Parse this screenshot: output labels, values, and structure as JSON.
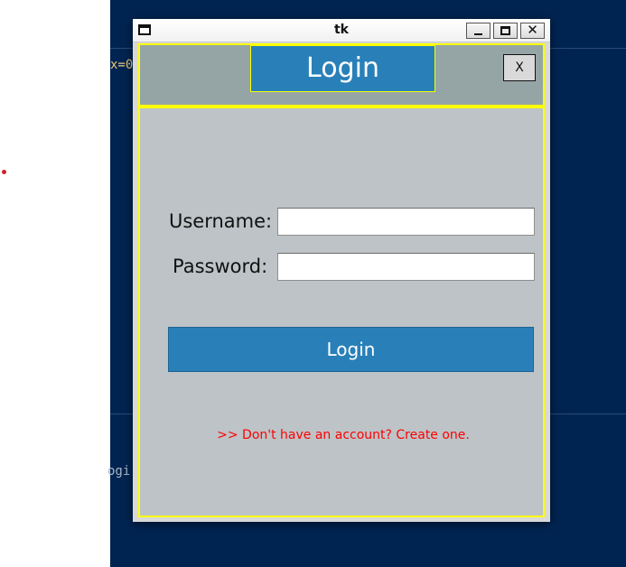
{
  "background": {
    "editor_line_1": "x=0",
    "editor_line_2": "",
    "editor_line_3": "ogi",
    "editor_line_4": ""
  },
  "window": {
    "title": "tk",
    "controls": {
      "minimize_icon": "minimize-icon",
      "maximize_icon": "maximize-icon",
      "close_glyph": "✕"
    }
  },
  "header": {
    "title": "Login",
    "close_button_label": "X"
  },
  "form": {
    "username_label": "Username:",
    "password_label": "Password:",
    "username_value": "",
    "password_value": "",
    "login_button_label": "Login",
    "signup_link": ">> Don't have an account? Create one."
  },
  "colors": {
    "header_bg": "#95a5a6",
    "body_bg": "#bdc3c7",
    "accent_blue": "#2980b9",
    "frame_border": "#ffff00",
    "link_red": "#ff0000",
    "editor_bg": "#002451"
  }
}
